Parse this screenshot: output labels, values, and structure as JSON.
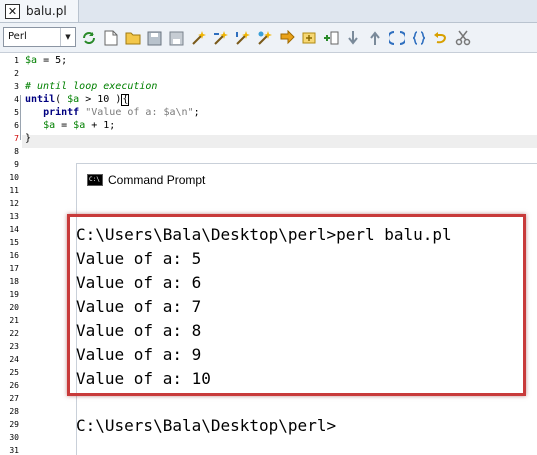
{
  "tab": {
    "title": "balu.pl",
    "close_glyph": "✕"
  },
  "toolbar": {
    "language": "Perl",
    "dropdown_glyph": "▼",
    "icons": [
      "refresh-icon",
      "new-file-icon",
      "open-folder-icon",
      "save-icon",
      "save-all-icon",
      "wand-icon",
      "wand-icon",
      "wand-icon",
      "wand-icon",
      "run-icon",
      "build-icon",
      "insert-icon",
      "down-arrow-icon",
      "up-arrow-icon",
      "brackets-icon",
      "braces-icon",
      "undo-icon",
      "scissors-icon"
    ],
    "accent": "#2f6fbf"
  },
  "editor": {
    "line_numbers": [
      "1",
      "2",
      "3",
      "4",
      "5",
      "6",
      "7",
      "8",
      "9",
      "10",
      "11",
      "12",
      "13",
      "14",
      "15",
      "16",
      "17",
      "18",
      "19",
      "20",
      "21",
      "22",
      "23",
      "24",
      "25",
      "26",
      "27",
      "28",
      "29",
      "30",
      "31"
    ],
    "current_line": "7",
    "colors": {
      "variable": "#008000",
      "keyword": "#000080",
      "comment": "#008000",
      "string": "#7a7a7a",
      "current_line_number": "#d00000"
    },
    "lines": [
      {
        "var": "$a",
        "rest": " = 5;"
      },
      {
        "text": ""
      },
      {
        "comment": "# until loop execution"
      },
      {
        "kw": "until",
        "p1": "( ",
        "var": "$a",
        "p2": " > ",
        "num": "10",
        "p3": " )",
        "caret": "{"
      },
      {
        "indent": "   ",
        "kw": "printf",
        "sp": " ",
        "str": "\"Value of a: $a\\n\"",
        "end": ";"
      },
      {
        "indent": "   ",
        "var1": "$a",
        "mid": " = ",
        "var2": "$a",
        "end": " + 1;"
      },
      {
        "text": "}"
      }
    ]
  },
  "command_prompt": {
    "title": "Command Prompt",
    "icon_text": "C:\\",
    "output": [
      "C:\\Users\\Bala\\Desktop\\perl>perl balu.pl",
      "Value of a: 5",
      "Value of a: 6",
      "Value of a: 7",
      "Value of a: 8",
      "Value of a: 9",
      "Value of a: 10",
      "",
      "C:\\Users\\Bala\\Desktop\\perl>"
    ],
    "highlight_color": "#c83a3a"
  }
}
